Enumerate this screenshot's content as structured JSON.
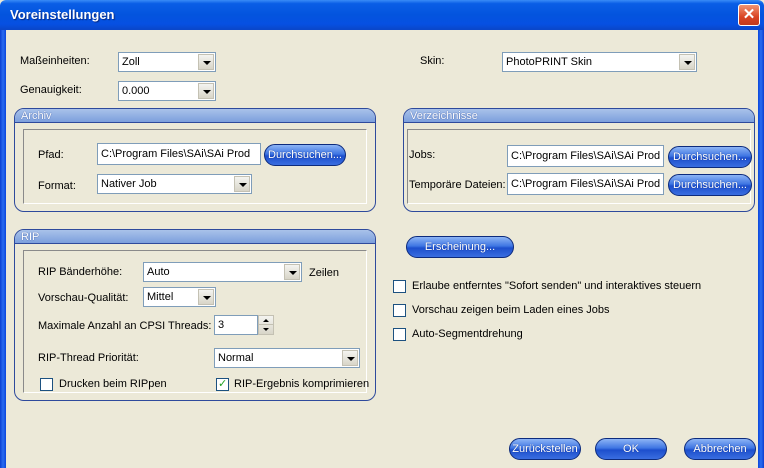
{
  "window": {
    "title": "Voreinstellungen",
    "close_symbol": "✕"
  },
  "units": {
    "label": "Maßeinheiten:",
    "value": "Zoll"
  },
  "precision": {
    "label": "Genauigkeit:",
    "value": "0.000"
  },
  "skin": {
    "label": "Skin:",
    "value": "PhotoPRINT Skin"
  },
  "archive": {
    "title": "Archiv",
    "path_label": "Pfad:",
    "path_value": "C:\\Program Files\\SAi\\SAi Prod",
    "browse_label": "Durchsuchen...",
    "format_label": "Format:",
    "format_value": "Nativer Job"
  },
  "directories": {
    "title": "Verzeichnisse",
    "jobs_label": "Jobs:",
    "jobs_value": "C:\\Program Files\\SAi\\SAi Prod",
    "jobs_browse": "Durchsuchen...",
    "temp_label": "Temporäre Dateien:",
    "temp_value": "C:\\Program Files\\SAi\\SAi Prod",
    "temp_browse": "Durchsuchen..."
  },
  "rip": {
    "title": "RIP",
    "band_height_label": "RIP Bänderhöhe:",
    "band_height_value": "Auto",
    "band_height_unit": "Zeilen",
    "preview_quality_label": "Vorschau-Qualität:",
    "preview_quality_value": "Mittel",
    "max_threads_label": "Maximale Anzahl an CPSI Threads:",
    "max_threads_value": "3",
    "thread_priority_label": "RIP-Thread Priorität:",
    "thread_priority_value": "Normal",
    "print_on_rip_label": "Drucken beim RIPpen",
    "print_on_rip_checked": false,
    "compress_label": "RIP-Ergebnis komprimieren",
    "compress_checked": true
  },
  "appearance_button": "Erscheinung...",
  "options": [
    {
      "label": "Erlaube entferntes \"Sofort senden\" und interaktives steuern",
      "checked": false
    },
    {
      "label": "Vorschau zeigen beim Laden eines Jobs",
      "checked": false
    },
    {
      "label": "Auto-Segmentdrehung",
      "checked": false
    }
  ],
  "footer": {
    "reset": "Zurückstellen",
    "ok": "OK",
    "cancel": "Abbrechen"
  }
}
